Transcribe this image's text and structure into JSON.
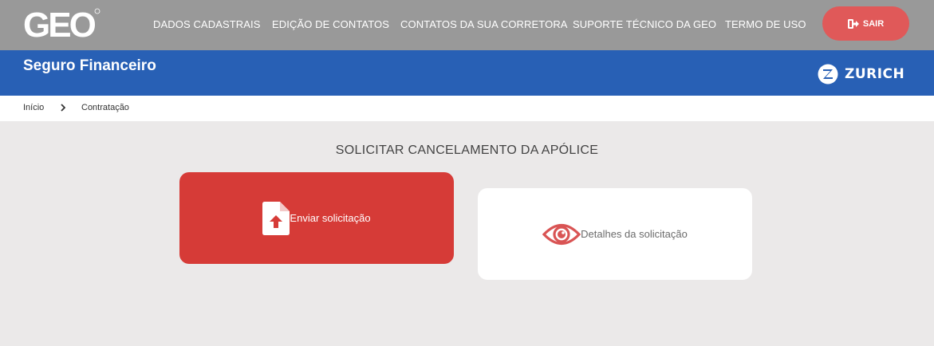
{
  "header": {
    "logo_text": "GEO",
    "nav": [
      {
        "label": "DADOS CADASTRAIS"
      },
      {
        "label": "EDIÇÃO DE CONTATOS"
      },
      {
        "label": "CONTATOS DA SUA CORRETORA"
      },
      {
        "label": "SUPORTE TÉCNICO DA GEO"
      },
      {
        "label": "TERMO DE USO"
      }
    ],
    "logout_label": "SAIR",
    "logout_color": "#e05959",
    "bar_color": "#999999"
  },
  "product_bar": {
    "title": "Seguro Financeiro",
    "brand_name": "ZURICH",
    "bar_color": "#2860b5"
  },
  "breadcrumb": {
    "items": [
      "Início",
      "Contratação"
    ]
  },
  "main": {
    "title": "SOLICITAR CANCELAMENTO DA APÓLICE",
    "cards": [
      {
        "label": "Enviar solicitação",
        "icon": "file-upload-icon",
        "color": "#d63b37"
      },
      {
        "label": "Detalhes da solicitação",
        "icon": "eye-icon",
        "color": "#ffffff"
      }
    ]
  }
}
